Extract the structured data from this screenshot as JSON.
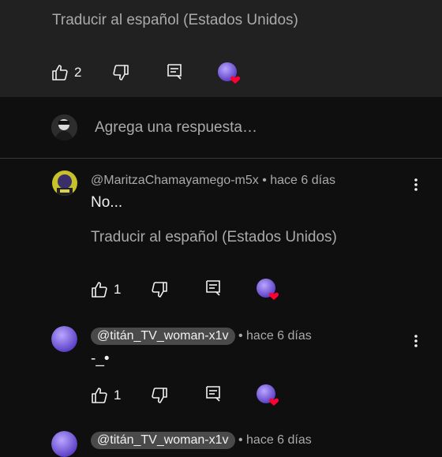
{
  "thread": {
    "parent_translate": "Traducir al español (Estados Unidos)",
    "parent_likes": "2"
  },
  "reply_box": {
    "placeholder": "Agrega una respuesta…"
  },
  "replies": [
    {
      "handle": "@MaritzaChamayamego-m5x",
      "time": "• hace 6 días",
      "text": "No...",
      "translate": "Traducir al español (Estados Unidos)",
      "likes": "1"
    },
    {
      "handle": "@titán_TV_woman-x1v",
      "time": "• hace 6 días",
      "text": "-_•",
      "likes": "1"
    },
    {
      "handle": "@titán_TV_woman-x1v",
      "time": "• hace 6 días"
    }
  ],
  "colors": {
    "background": "#0f0f0f",
    "parent_panel": "#212121",
    "heart": "#ff0033",
    "avatar_purple": "#7b5fd6"
  }
}
